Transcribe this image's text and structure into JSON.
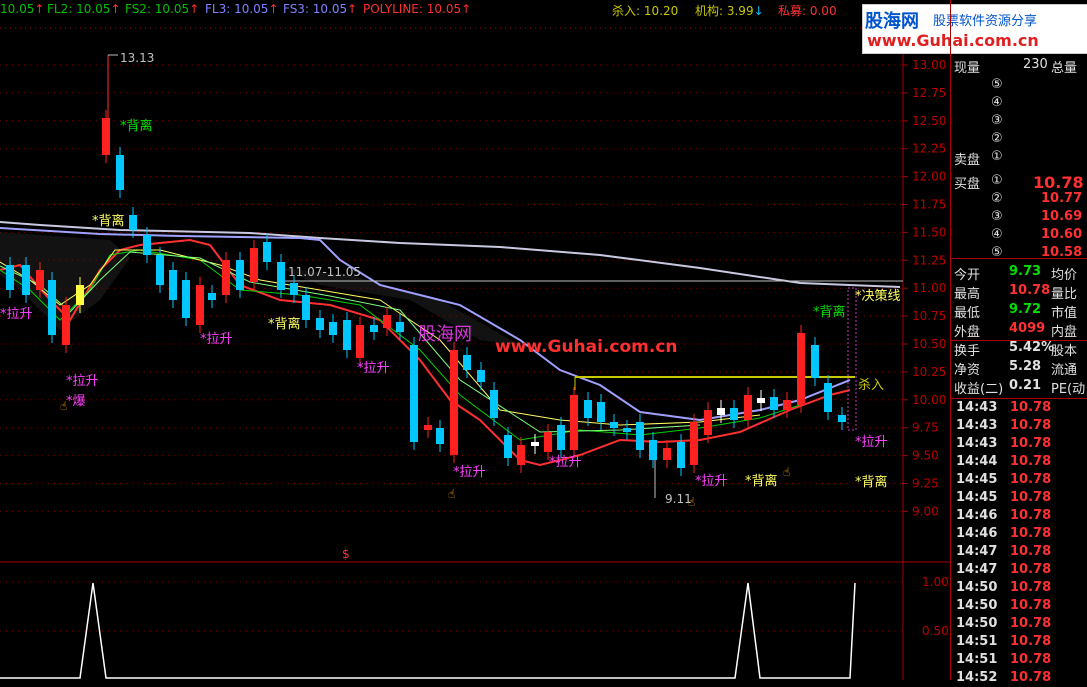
{
  "indicators": [
    {
      "text": "10.05",
      "color": "#00c000",
      "arrow": "↑"
    },
    {
      "text": "FL2: 10.05",
      "color": "#00c000",
      "arrow": "↑"
    },
    {
      "text": "FS2: 10.05",
      "color": "#00c000",
      "arrow": "↑"
    },
    {
      "text": "FL3: 10.05",
      "color": "#8080ff",
      "arrow": "↑"
    },
    {
      "text": "FS3: 10.05",
      "color": "#8080ff",
      "arrow": "↑"
    },
    {
      "text": "POLYLINE: 10.05",
      "color": "#ff3030",
      "arrow": "↑"
    },
    {
      "text": "杀入: 10.20",
      "color": "#c8c800",
      "arrow": ""
    },
    {
      "text": "机构: 3.99",
      "color": "#c8c800",
      "arrow": "↓"
    },
    {
      "text": "私募: 0.00",
      "color": "#ff3030",
      "arrow": ""
    }
  ],
  "logo": {
    "title": "股海网",
    "subtitle": "股票软件资源分享",
    "url": "www.Guhai.com.cn"
  },
  "watermark": {
    "cn": "股海网",
    "url": "www.Guhai.com.cn"
  },
  "price_axis": [
    "13.00",
    "12.75",
    "12.50",
    "12.25",
    "12.00",
    "11.75",
    "11.50",
    "11.25",
    "11.00",
    "10.75",
    "10.50",
    "10.25",
    "10.00",
    "9.75",
    "9.50",
    "9.25",
    "9.00"
  ],
  "sub_axis": [
    "1.00",
    "0.50"
  ],
  "annotations": {
    "high": "13.13",
    "low": "9.11",
    "range": "11.07-11.05",
    "beili": "*背离",
    "lasheng": "*拉升",
    "bao": "*爆",
    "juece": "*决策线",
    "sharu": "杀入",
    "dollar": "$"
  },
  "quote": {
    "xianliang_label": "现量",
    "xianliang": "230",
    "zongliang_label": "总量",
    "sell_label": "卖盘",
    "buy_label": "买盘",
    "sell_levels": [
      "⑤",
      "④",
      "③",
      "②",
      "①"
    ],
    "buy_levels": [
      {
        "lvl": "①",
        "price": "10.78"
      },
      {
        "lvl": "②",
        "price": "10.77"
      },
      {
        "lvl": "③",
        "price": "10.69"
      },
      {
        "lvl": "④",
        "price": "10.60"
      },
      {
        "lvl": "⑤",
        "price": "10.58"
      }
    ],
    "stats": [
      {
        "l": "今开",
        "v": "9.73",
        "c": "#00e000",
        "r": "均价"
      },
      {
        "l": "最高",
        "v": "10.78",
        "c": "#ff3030",
        "r": "量比"
      },
      {
        "l": "最低",
        "v": "9.72",
        "c": "#00e000",
        "r": "市值"
      },
      {
        "l": "外盘",
        "v": "4099",
        "c": "#ff3030",
        "r": "内盘"
      },
      {
        "l": "换手",
        "v": "5.42%",
        "c": "#e0e0e0",
        "r": "股本"
      },
      {
        "l": "净资",
        "v": "5.28",
        "c": "#e0e0e0",
        "r": "流通"
      },
      {
        "l": "收益(二)",
        "v": "0.21",
        "c": "#e0e0e0",
        "r": "PE(动"
      }
    ],
    "ticks": [
      {
        "t": "14:43",
        "p": "10.78"
      },
      {
        "t": "14:43",
        "p": "10.78"
      },
      {
        "t": "14:43",
        "p": "10.78"
      },
      {
        "t": "14:44",
        "p": "10.78"
      },
      {
        "t": "14:45",
        "p": "10.78"
      },
      {
        "t": "14:45",
        "p": "10.78"
      },
      {
        "t": "14:46",
        "p": "10.78"
      },
      {
        "t": "14:46",
        "p": "10.78"
      },
      {
        "t": "14:47",
        "p": "10.78"
      },
      {
        "t": "14:47",
        "p": "10.78"
      },
      {
        "t": "14:50",
        "p": "10.78"
      },
      {
        "t": "14:50",
        "p": "10.78"
      },
      {
        "t": "14:50",
        "p": "10.78"
      },
      {
        "t": "14:51",
        "p": "10.78"
      },
      {
        "t": "14:51",
        "p": "10.78"
      },
      {
        "t": "14:52",
        "p": "10.78"
      }
    ]
  }
}
